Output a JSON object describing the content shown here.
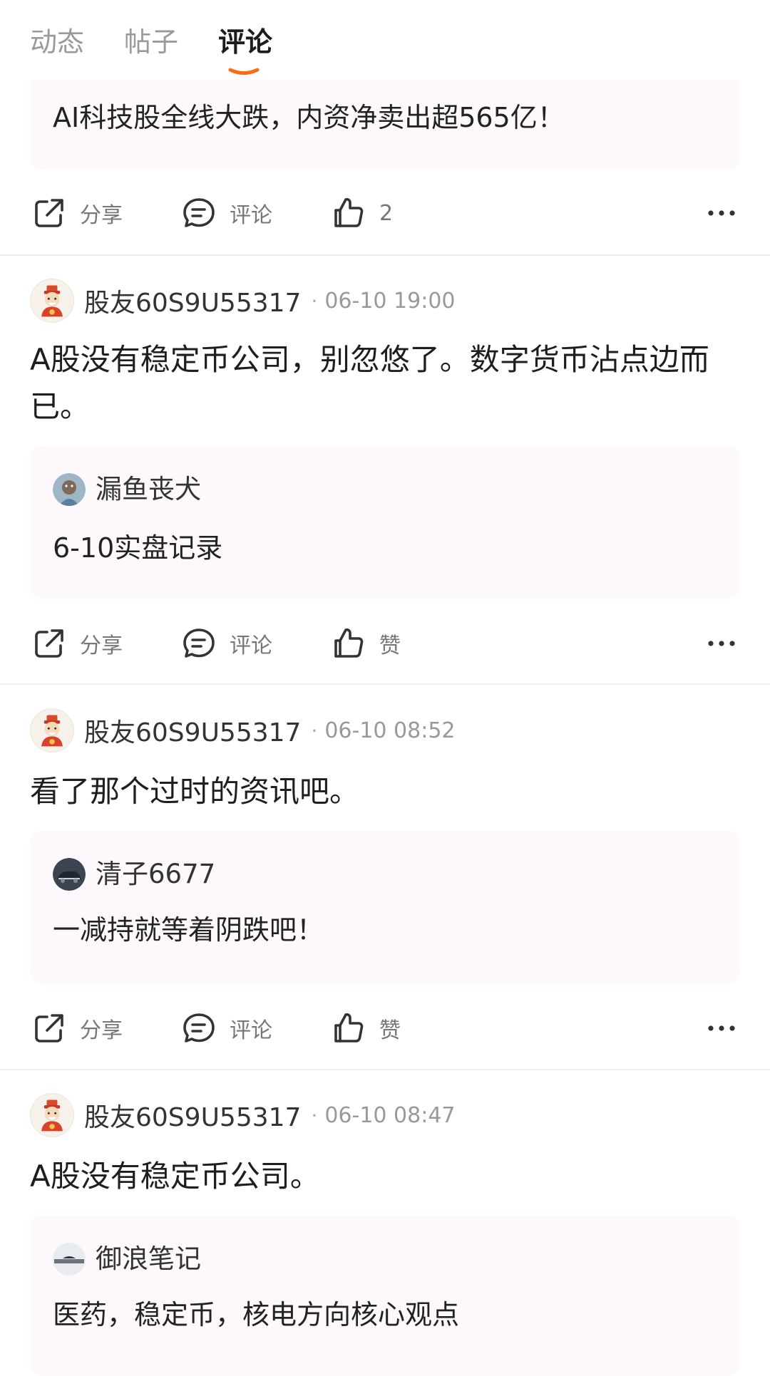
{
  "tabs": [
    {
      "label": "动态",
      "active": false
    },
    {
      "label": "帖子",
      "active": false
    },
    {
      "label": "评论",
      "active": true
    }
  ],
  "colors": {
    "accent": "#ff6a13",
    "quote_bg": "#fcf8fc"
  },
  "top_fragment": {
    "quote_text": "AI科技股全线大跌，内资净卖出超565亿！",
    "actions": {
      "share": "分享",
      "comment": "评论",
      "like": "2"
    }
  },
  "posts": [
    {
      "author": "股友60S9U55317",
      "time": "06-10 19:00",
      "body": "A股没有稳定币公司，别忽悠了。数字货币沾点边而已。",
      "quote": {
        "author": "漏鱼丧犬",
        "text": "6-10实盘记录"
      },
      "actions": {
        "share": "分享",
        "comment": "评论",
        "like": "赞"
      }
    },
    {
      "author": "股友60S9U55317",
      "time": "06-10 08:52",
      "body": "看了那个过时的资讯吧。",
      "quote": {
        "author": "清子6677",
        "text": "一减持就等着阴跌吧！"
      },
      "actions": {
        "share": "分享",
        "comment": "评论",
        "like": "赞"
      }
    },
    {
      "author": "股友60S9U55317",
      "time": "06-10 08:47",
      "body": "A股没有稳定币公司。",
      "quote": {
        "author": "御浪笔记",
        "text": "医药，稳定币，核电方向核心观点"
      }
    }
  ],
  "separator": "·"
}
